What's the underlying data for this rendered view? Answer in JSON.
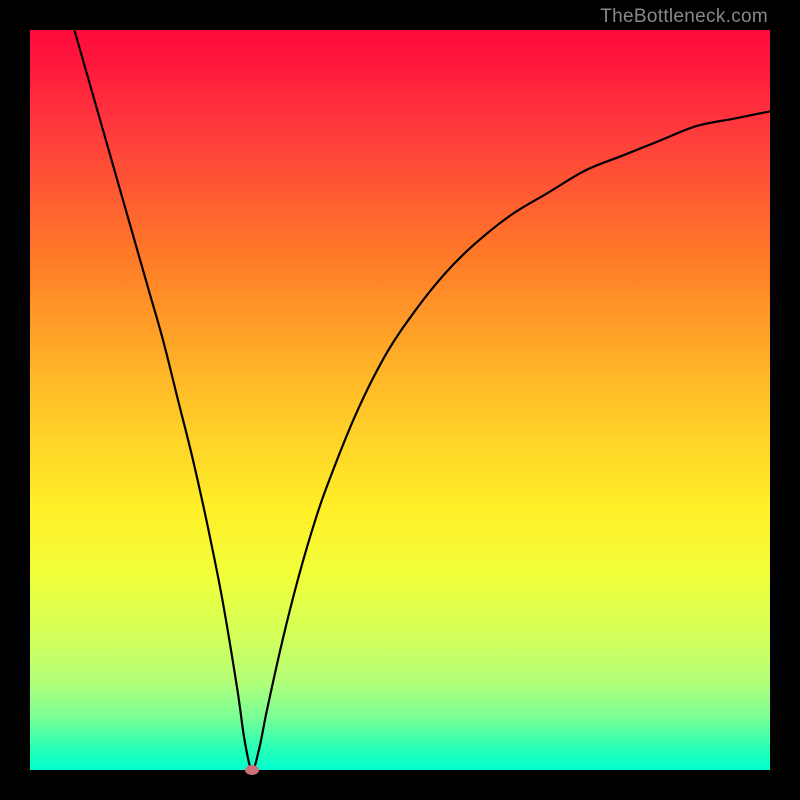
{
  "watermark": "TheBottleneck.com",
  "chart_data": {
    "type": "line",
    "title": "",
    "xlabel": "",
    "ylabel": "",
    "xlim": [
      0,
      100
    ],
    "ylim": [
      0,
      100
    ],
    "series": [
      {
        "name": "curve",
        "x": [
          6,
          8,
          10,
          12,
          14,
          16,
          18,
          20,
          22,
          24,
          26,
          28,
          29,
          30,
          31,
          32,
          34,
          36,
          38,
          40,
          44,
          48,
          52,
          56,
          60,
          65,
          70,
          75,
          80,
          85,
          90,
          95,
          100
        ],
        "y": [
          100,
          93,
          86,
          79,
          72,
          65,
          58,
          50,
          42,
          33,
          23,
          11,
          4,
          0,
          3,
          8,
          17,
          25,
          32,
          38,
          48,
          56,
          62,
          67,
          71,
          75,
          78,
          81,
          83,
          85,
          87,
          88,
          89
        ]
      }
    ],
    "marker": {
      "x": 30,
      "y": 0
    },
    "gradient": {
      "top": "#ff0a3c",
      "mid": "#ffd228",
      "bottom": "#00ffd2"
    }
  }
}
